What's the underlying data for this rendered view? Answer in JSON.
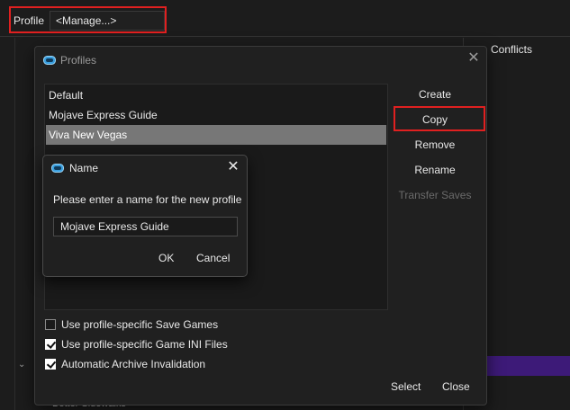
{
  "main": {
    "profile_label": "Profile",
    "profile_value": "<Manage...>",
    "conflicts_label": "Conflicts",
    "bg_bottom_text": "Better Sidewalks",
    "accent_purple": "#3d1a78",
    "highlight_color": "#e02020"
  },
  "profiles_dialog": {
    "title": "Profiles",
    "items": [
      {
        "label": "Default",
        "selected": false
      },
      {
        "label": "Mojave Express Guide",
        "selected": false
      },
      {
        "label": "Viva New Vegas",
        "selected": true
      }
    ],
    "buttons": {
      "create": "Create",
      "copy": "Copy",
      "remove": "Remove",
      "rename": "Rename",
      "transfer": "Transfer Saves"
    },
    "checkboxes": [
      {
        "label": "Use profile-specific Save Games",
        "checked": false
      },
      {
        "label": "Use profile-specific Game INI Files",
        "checked": true
      },
      {
        "label": "Automatic Archive Invalidation",
        "checked": true
      }
    ],
    "select": "Select",
    "close": "Close"
  },
  "name_dialog": {
    "title": "Name",
    "prompt": "Please enter a name for the new profile",
    "input_value": "Mojave Express Guide",
    "ok": "OK",
    "cancel": "Cancel"
  }
}
